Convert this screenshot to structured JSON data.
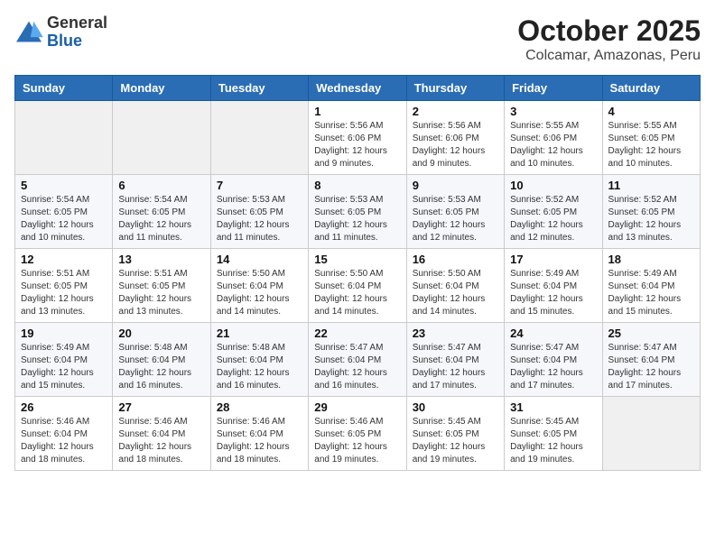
{
  "header": {
    "logo_line1": "General",
    "logo_line2": "Blue",
    "month_year": "October 2025",
    "location": "Colcamar, Amazonas, Peru"
  },
  "weekdays": [
    "Sunday",
    "Monday",
    "Tuesday",
    "Wednesday",
    "Thursday",
    "Friday",
    "Saturday"
  ],
  "weeks": [
    [
      {
        "day": "",
        "sunrise": "",
        "sunset": "",
        "daylight": ""
      },
      {
        "day": "",
        "sunrise": "",
        "sunset": "",
        "daylight": ""
      },
      {
        "day": "",
        "sunrise": "",
        "sunset": "",
        "daylight": ""
      },
      {
        "day": "1",
        "sunrise": "Sunrise: 5:56 AM",
        "sunset": "Sunset: 6:06 PM",
        "daylight": "Daylight: 12 hours and 9 minutes."
      },
      {
        "day": "2",
        "sunrise": "Sunrise: 5:56 AM",
        "sunset": "Sunset: 6:06 PM",
        "daylight": "Daylight: 12 hours and 9 minutes."
      },
      {
        "day": "3",
        "sunrise": "Sunrise: 5:55 AM",
        "sunset": "Sunset: 6:06 PM",
        "daylight": "Daylight: 12 hours and 10 minutes."
      },
      {
        "day": "4",
        "sunrise": "Sunrise: 5:55 AM",
        "sunset": "Sunset: 6:05 PM",
        "daylight": "Daylight: 12 hours and 10 minutes."
      }
    ],
    [
      {
        "day": "5",
        "sunrise": "Sunrise: 5:54 AM",
        "sunset": "Sunset: 6:05 PM",
        "daylight": "Daylight: 12 hours and 10 minutes."
      },
      {
        "day": "6",
        "sunrise": "Sunrise: 5:54 AM",
        "sunset": "Sunset: 6:05 PM",
        "daylight": "Daylight: 12 hours and 11 minutes."
      },
      {
        "day": "7",
        "sunrise": "Sunrise: 5:53 AM",
        "sunset": "Sunset: 6:05 PM",
        "daylight": "Daylight: 12 hours and 11 minutes."
      },
      {
        "day": "8",
        "sunrise": "Sunrise: 5:53 AM",
        "sunset": "Sunset: 6:05 PM",
        "daylight": "Daylight: 12 hours and 11 minutes."
      },
      {
        "day": "9",
        "sunrise": "Sunrise: 5:53 AM",
        "sunset": "Sunset: 6:05 PM",
        "daylight": "Daylight: 12 hours and 12 minutes."
      },
      {
        "day": "10",
        "sunrise": "Sunrise: 5:52 AM",
        "sunset": "Sunset: 6:05 PM",
        "daylight": "Daylight: 12 hours and 12 minutes."
      },
      {
        "day": "11",
        "sunrise": "Sunrise: 5:52 AM",
        "sunset": "Sunset: 6:05 PM",
        "daylight": "Daylight: 12 hours and 13 minutes."
      }
    ],
    [
      {
        "day": "12",
        "sunrise": "Sunrise: 5:51 AM",
        "sunset": "Sunset: 6:05 PM",
        "daylight": "Daylight: 12 hours and 13 minutes."
      },
      {
        "day": "13",
        "sunrise": "Sunrise: 5:51 AM",
        "sunset": "Sunset: 6:05 PM",
        "daylight": "Daylight: 12 hours and 13 minutes."
      },
      {
        "day": "14",
        "sunrise": "Sunrise: 5:50 AM",
        "sunset": "Sunset: 6:04 PM",
        "daylight": "Daylight: 12 hours and 14 minutes."
      },
      {
        "day": "15",
        "sunrise": "Sunrise: 5:50 AM",
        "sunset": "Sunset: 6:04 PM",
        "daylight": "Daylight: 12 hours and 14 minutes."
      },
      {
        "day": "16",
        "sunrise": "Sunrise: 5:50 AM",
        "sunset": "Sunset: 6:04 PM",
        "daylight": "Daylight: 12 hours and 14 minutes."
      },
      {
        "day": "17",
        "sunrise": "Sunrise: 5:49 AM",
        "sunset": "Sunset: 6:04 PM",
        "daylight": "Daylight: 12 hours and 15 minutes."
      },
      {
        "day": "18",
        "sunrise": "Sunrise: 5:49 AM",
        "sunset": "Sunset: 6:04 PM",
        "daylight": "Daylight: 12 hours and 15 minutes."
      }
    ],
    [
      {
        "day": "19",
        "sunrise": "Sunrise: 5:49 AM",
        "sunset": "Sunset: 6:04 PM",
        "daylight": "Daylight: 12 hours and 15 minutes."
      },
      {
        "day": "20",
        "sunrise": "Sunrise: 5:48 AM",
        "sunset": "Sunset: 6:04 PM",
        "daylight": "Daylight: 12 hours and 16 minutes."
      },
      {
        "day": "21",
        "sunrise": "Sunrise: 5:48 AM",
        "sunset": "Sunset: 6:04 PM",
        "daylight": "Daylight: 12 hours and 16 minutes."
      },
      {
        "day": "22",
        "sunrise": "Sunrise: 5:47 AM",
        "sunset": "Sunset: 6:04 PM",
        "daylight": "Daylight: 12 hours and 16 minutes."
      },
      {
        "day": "23",
        "sunrise": "Sunrise: 5:47 AM",
        "sunset": "Sunset: 6:04 PM",
        "daylight": "Daylight: 12 hours and 17 minutes."
      },
      {
        "day": "24",
        "sunrise": "Sunrise: 5:47 AM",
        "sunset": "Sunset: 6:04 PM",
        "daylight": "Daylight: 12 hours and 17 minutes."
      },
      {
        "day": "25",
        "sunrise": "Sunrise: 5:47 AM",
        "sunset": "Sunset: 6:04 PM",
        "daylight": "Daylight: 12 hours and 17 minutes."
      }
    ],
    [
      {
        "day": "26",
        "sunrise": "Sunrise: 5:46 AM",
        "sunset": "Sunset: 6:04 PM",
        "daylight": "Daylight: 12 hours and 18 minutes."
      },
      {
        "day": "27",
        "sunrise": "Sunrise: 5:46 AM",
        "sunset": "Sunset: 6:04 PM",
        "daylight": "Daylight: 12 hours and 18 minutes."
      },
      {
        "day": "28",
        "sunrise": "Sunrise: 5:46 AM",
        "sunset": "Sunset: 6:04 PM",
        "daylight": "Daylight: 12 hours and 18 minutes."
      },
      {
        "day": "29",
        "sunrise": "Sunrise: 5:46 AM",
        "sunset": "Sunset: 6:05 PM",
        "daylight": "Daylight: 12 hours and 19 minutes."
      },
      {
        "day": "30",
        "sunrise": "Sunrise: 5:45 AM",
        "sunset": "Sunset: 6:05 PM",
        "daylight": "Daylight: 12 hours and 19 minutes."
      },
      {
        "day": "31",
        "sunrise": "Sunrise: 5:45 AM",
        "sunset": "Sunset: 6:05 PM",
        "daylight": "Daylight: 12 hours and 19 minutes."
      },
      {
        "day": "",
        "sunrise": "",
        "sunset": "",
        "daylight": ""
      }
    ]
  ]
}
